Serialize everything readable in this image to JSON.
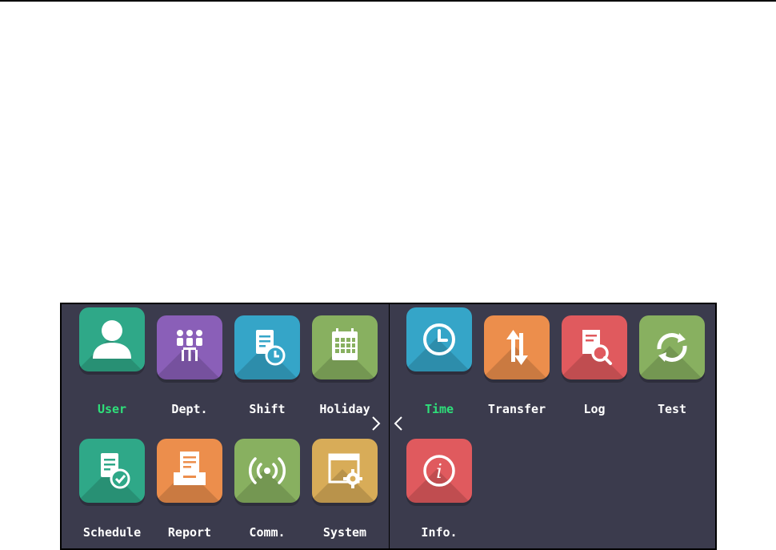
{
  "panels": {
    "left": {
      "items": [
        {
          "label": "User",
          "icon": "user-icon",
          "color": "#2fa888",
          "selected": true
        },
        {
          "label": "Dept.",
          "icon": "department-icon",
          "color": "#8a5fb8",
          "selected": false
        },
        {
          "label": "Shift",
          "icon": "shift-icon",
          "color": "#35a5c8",
          "selected": false
        },
        {
          "label": "Holiday",
          "icon": "calendar-icon",
          "color": "#88b060",
          "selected": false
        },
        {
          "label": "Schedule",
          "icon": "schedule-icon",
          "color": "#2fa888",
          "selected": false
        },
        {
          "label": "Report",
          "icon": "report-icon",
          "color": "#ec8e4c",
          "selected": false
        },
        {
          "label": "Comm.",
          "icon": "wireless-icon",
          "color": "#88b060",
          "selected": false
        },
        {
          "label": "System",
          "icon": "system-settings-icon",
          "color": "#d8ac58",
          "selected": false
        }
      ]
    },
    "right": {
      "items": [
        {
          "label": "Time",
          "icon": "clock-icon",
          "color": "#35a5c8",
          "selected": true
        },
        {
          "label": "Transfer",
          "icon": "transfer-icon",
          "color": "#ec8e4c",
          "selected": false
        },
        {
          "label": "Log",
          "icon": "log-search-icon",
          "color": "#e05a5e",
          "selected": false
        },
        {
          "label": "Test",
          "icon": "refresh-icon",
          "color": "#88b060",
          "selected": false
        },
        {
          "label": "Info.",
          "icon": "info-icon",
          "color": "#e05a5e",
          "selected": false
        }
      ]
    }
  },
  "colors": {
    "panel_bg": "#3b3b4d",
    "label_text": "#ffffff",
    "active_label": "#2ee07a"
  }
}
